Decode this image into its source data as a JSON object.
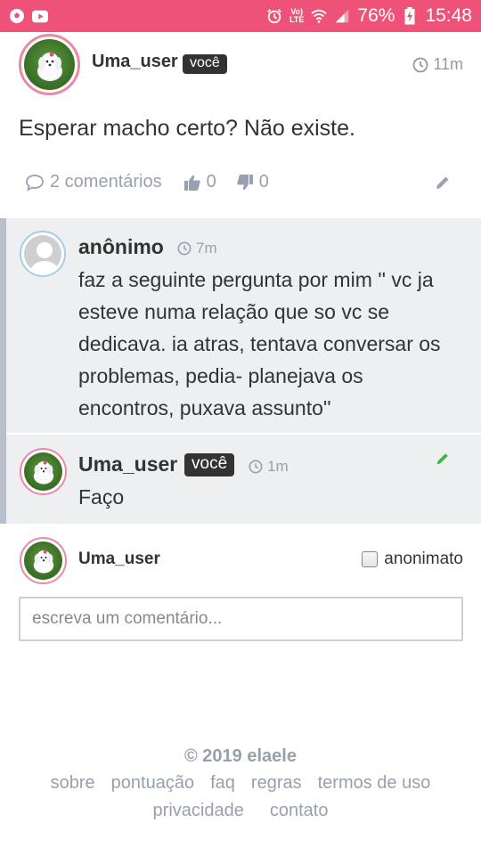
{
  "status_bar": {
    "volte": "Vo)",
    "lte": "LTE",
    "battery": "76%",
    "time": "15:48"
  },
  "post": {
    "username": "Uma_user",
    "badge": "você",
    "time": "11m",
    "text": "Esperar macho certo? Não existe.",
    "comments_label": "2 comentários",
    "likes": "0",
    "dislikes": "0"
  },
  "comments": [
    {
      "username": "anônimo",
      "time": "7m",
      "lines": [
        "faz a seguinte pergunta por mim '' vc ja",
        "esteve numa relação que so vc se",
        "dedicava. ia atras, tentava conversar os",
        "problemas, pedia- planejava os",
        "encontros, puxava assunto''"
      ]
    },
    {
      "username": "Uma_user",
      "badge": "você",
      "time": "1m",
      "text": "Faço"
    }
  ],
  "compose": {
    "username": "Uma_user",
    "anon_label": "anonimato",
    "placeholder": "escreva um comentário..."
  },
  "footer": {
    "copyright": "© 2019 elaele",
    "links_row1": [
      "sobre",
      "pontuação",
      "faq",
      "regras",
      "termos de uso"
    ],
    "links_row2": [
      "privacidade",
      "contato"
    ]
  },
  "colors": {
    "status_bar": "#ee5278",
    "avatar_ring": "#ea8aa3",
    "muted": "#99a0b0",
    "comment_bg": "#eeeff1",
    "edit_green": "#2fbf3a"
  }
}
